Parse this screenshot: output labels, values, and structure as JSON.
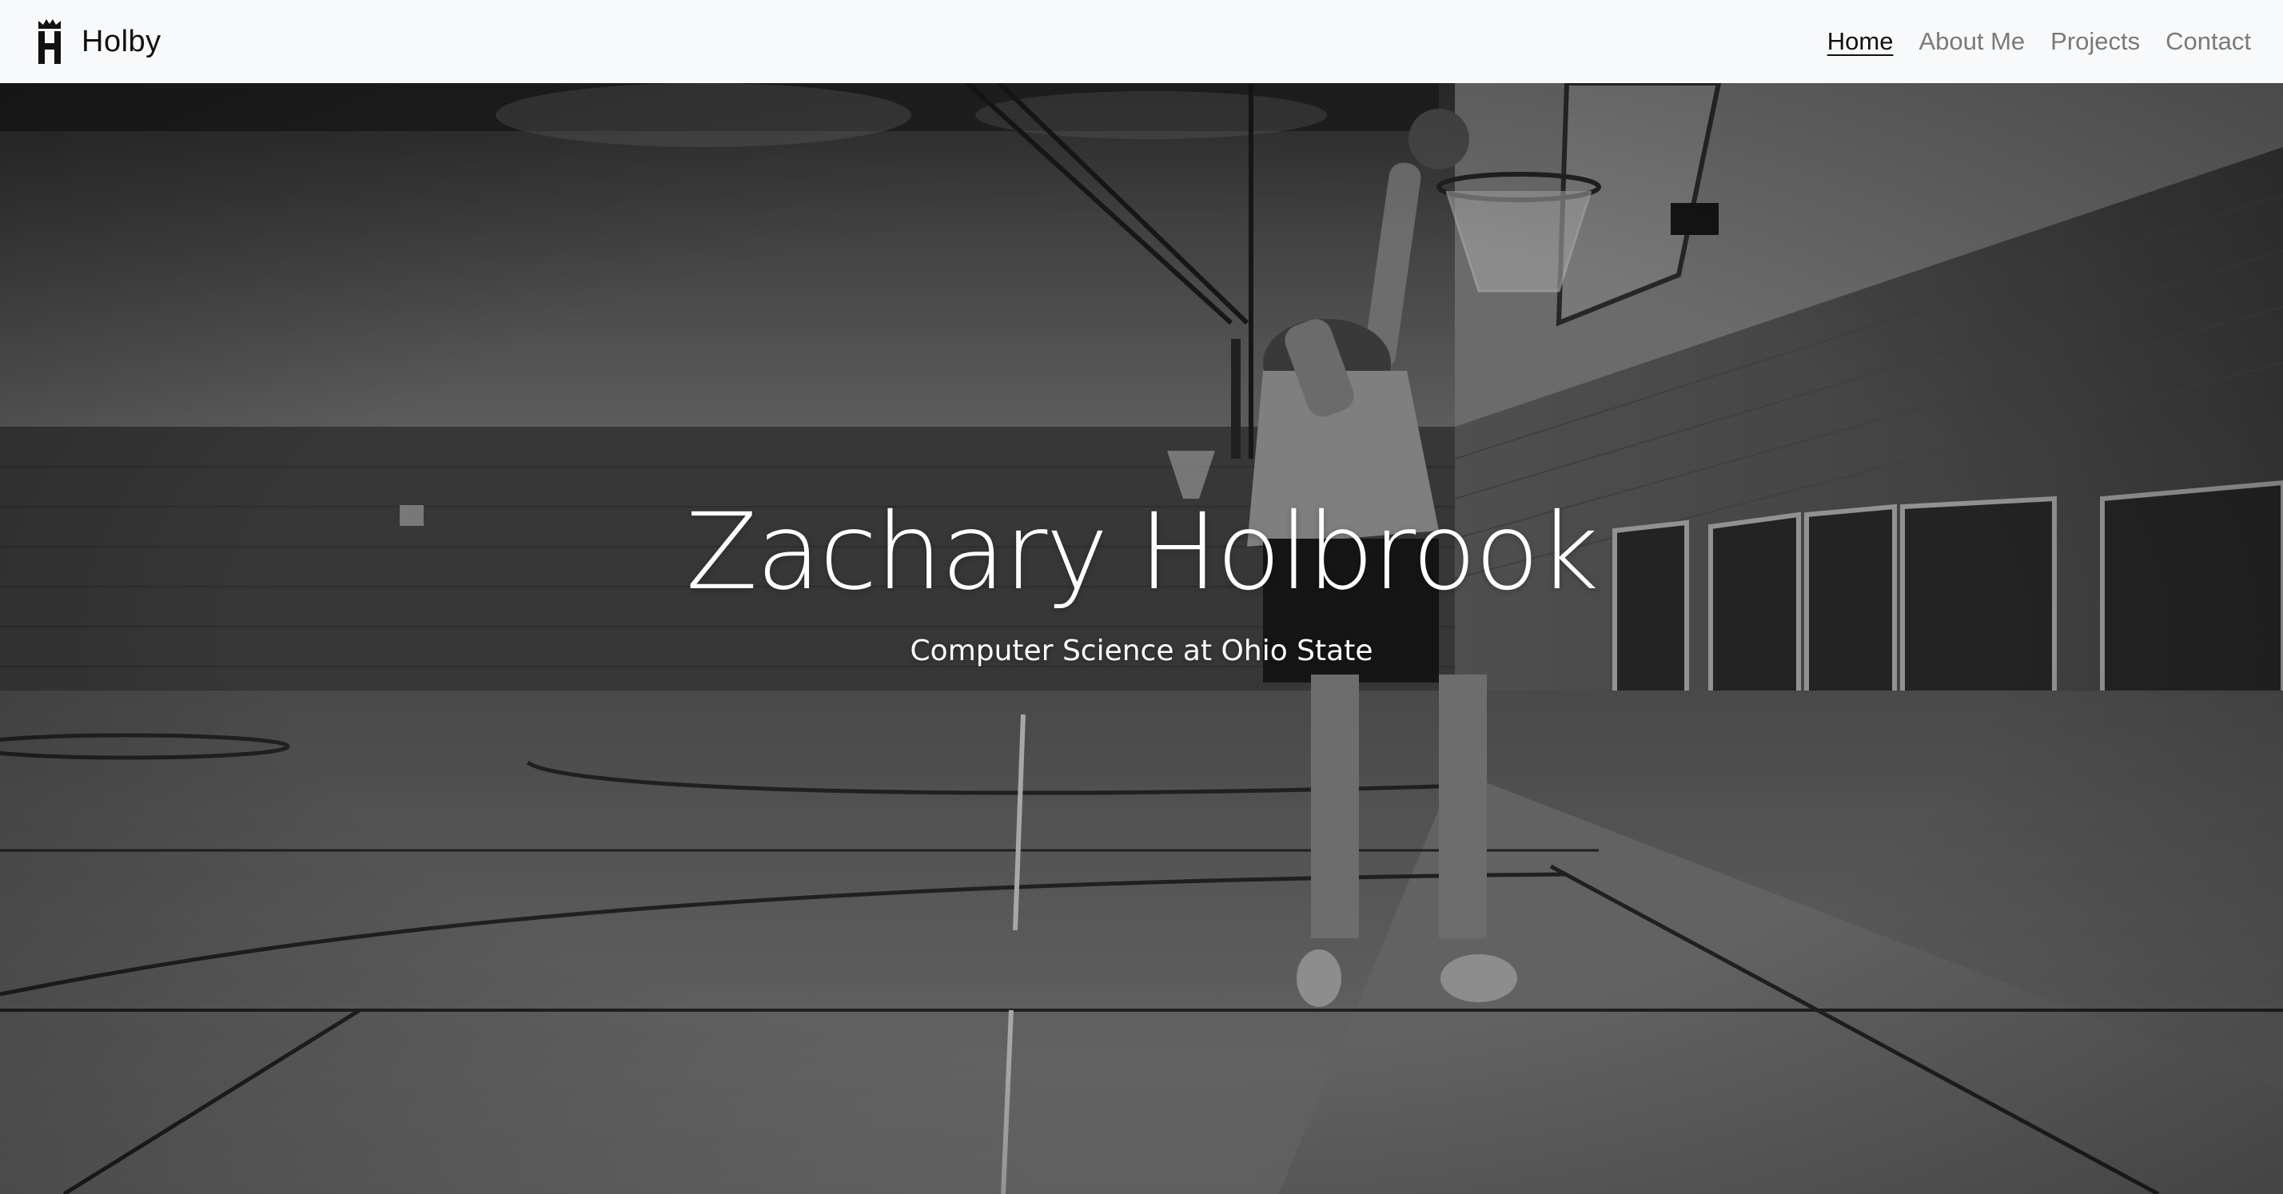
{
  "navbar": {
    "brand_name": "Holby",
    "brand_icon": "crown-h-logo-icon",
    "links": [
      {
        "label": "Home",
        "active": true
      },
      {
        "label": "About Me",
        "active": false
      },
      {
        "label": "Projects",
        "active": false
      },
      {
        "label": "Contact",
        "active": false
      }
    ]
  },
  "hero": {
    "title": "Zachary Holbrook",
    "subtitle": "Computer Science at Ohio State",
    "background": "grayscale-gym-basketball-dunk-photo"
  },
  "colors": {
    "navbar_bg": "#f8f9fa",
    "nav_active": "#111111",
    "nav_inactive": "#7a7a7a",
    "hero_text": "#ffffff"
  }
}
